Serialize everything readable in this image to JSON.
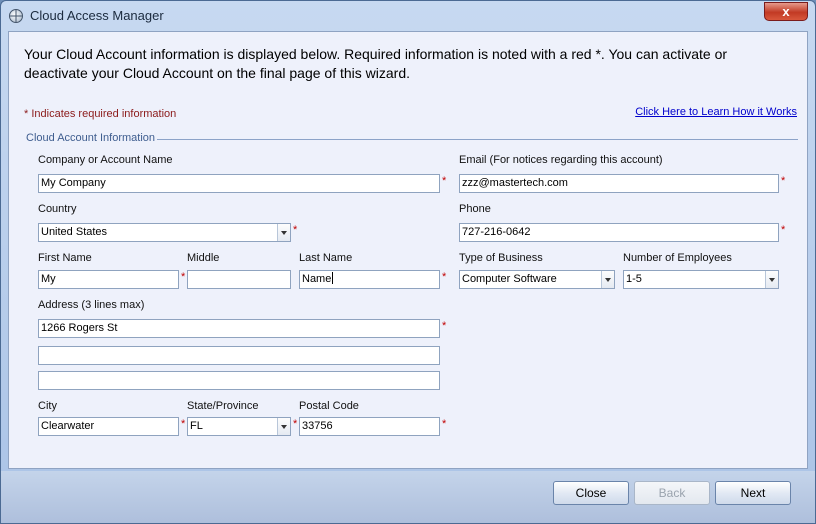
{
  "window": {
    "title": "Cloud Access Manager",
    "close_glyph": "x"
  },
  "header": {
    "text": "Your Cloud Account information is displayed below. Required information is noted with a red *. You can activate or deactivate your Cloud Account on the final page of this wizard.",
    "required_note": "* Indicates required information",
    "learn_link": "Click Here to Learn How it Works"
  },
  "section": {
    "title": "Cloud Account Information"
  },
  "required_marker": "*",
  "form": {
    "company": {
      "label": "Company or Account Name",
      "value": "My Company"
    },
    "email": {
      "label": "Email (For notices regarding this account)",
      "value": "zzz@mastertech.com"
    },
    "country": {
      "label": "Country",
      "value": "United States"
    },
    "phone": {
      "label": "Phone",
      "value": "727-216-0642"
    },
    "first_name": {
      "label": "First Name",
      "value": "My"
    },
    "middle": {
      "label": "Middle",
      "value": ""
    },
    "last_name": {
      "label": "Last Name",
      "value": "Name"
    },
    "business_type": {
      "label": "Type of Business",
      "value": "Computer Software"
    },
    "employees": {
      "label": "Number of Employees",
      "value": "1-5"
    },
    "address": {
      "label": "Address (3 lines max)",
      "line1": "1266 Rogers St",
      "line2": "",
      "line3": ""
    },
    "city": {
      "label": "City",
      "value": "Clearwater"
    },
    "state": {
      "label": "State/Province",
      "value": "FL"
    },
    "postal": {
      "label": "Postal Code",
      "value": "33756"
    }
  },
  "footer": {
    "close_label": "Close",
    "back_label": "Back",
    "next_label": "Next"
  },
  "icons": {
    "app": "globe-icon",
    "dropdown": "chevron-down-icon"
  }
}
